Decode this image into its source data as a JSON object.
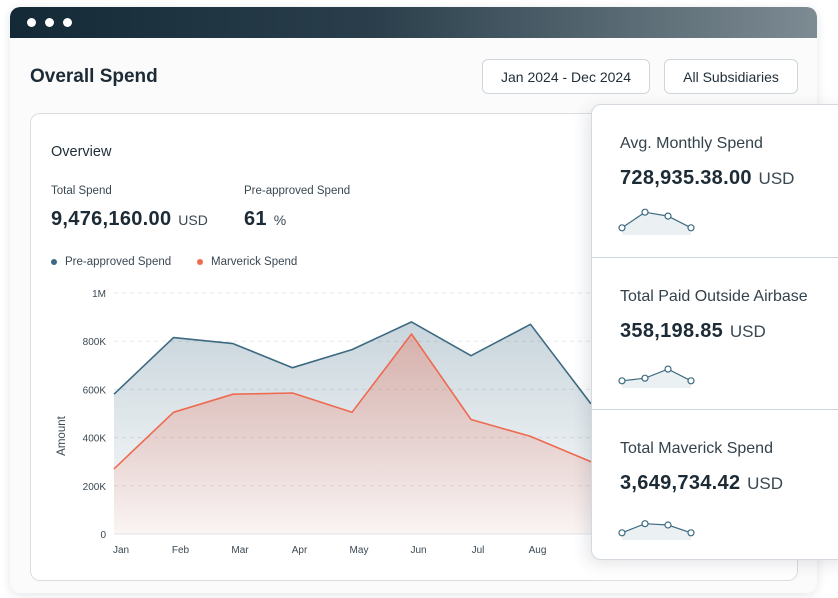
{
  "page": {
    "title": "Overall Spend"
  },
  "filters": {
    "date_range": "Jan 2024 - Dec 2024",
    "subsidiary": "All Subsidiaries"
  },
  "overview": {
    "title": "Overview",
    "total_spend_label": "Total Spend",
    "total_spend_value": "9,476,160.00",
    "total_spend_unit": "USD",
    "preapproved_label": "Pre-approved Spend",
    "preapproved_value": "61",
    "preapproved_unit": "%"
  },
  "legend": {
    "series1": "Pre-approved Spend",
    "series2": "Marverick Spend"
  },
  "colors": {
    "preapproved": "#3d6a82",
    "maverick": "#ee6a50",
    "titlebar": "#132a36"
  },
  "chart_data": {
    "type": "area",
    "categories": [
      "Jan",
      "Feb",
      "Mar",
      "Apr",
      "May",
      "Jun",
      "Jul",
      "Aug"
    ],
    "series": [
      {
        "name": "Pre-approved Spend",
        "values": [
          580000,
          815000,
          790000,
          690000,
          765000,
          880000,
          740000,
          870000
        ]
      },
      {
        "name": "Marverick Spend",
        "values": [
          270000,
          505000,
          580000,
          585000,
          505000,
          830000,
          475000,
          405000
        ]
      }
    ],
    "yticks": [
      "0",
      "200K",
      "400K",
      "600K",
      "800K",
      "1M"
    ],
    "ylabel": "Amount",
    "ylim": [
      0,
      1000000
    ],
    "grid": true
  },
  "metrics": [
    {
      "label": "Avg. Monthly Spend",
      "value": "728,935.38.00",
      "unit": "USD",
      "spark": [
        0.2,
        0.8,
        0.65,
        0.2
      ]
    },
    {
      "label": "Total Paid Outside Airbase",
      "value": "358,198.85",
      "unit": "USD",
      "spark": [
        0.2,
        0.3,
        0.65,
        0.2
      ]
    },
    {
      "label": "Total Maverick Spend",
      "value": "3,649,734.42",
      "unit": "USD",
      "spark": [
        0.2,
        0.55,
        0.5,
        0.2
      ]
    }
  ]
}
